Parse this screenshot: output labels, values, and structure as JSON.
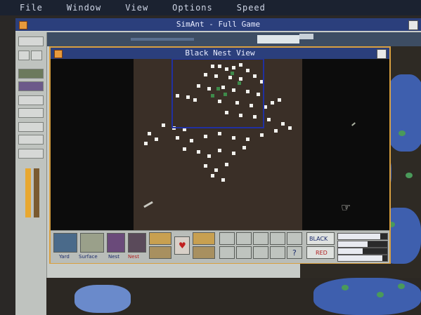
{
  "menubar": {
    "items": [
      "File",
      "Window",
      "View",
      "Options",
      "Speed"
    ]
  },
  "main_window": {
    "title": "SimAnt - Full Game"
  },
  "sub_window": {
    "title": "Black Nest View"
  },
  "controls": {
    "yard_label": "Yard",
    "surface_label": "Surface",
    "nest_label": "Nest",
    "nest2_label": "Nest",
    "black_label": "BLACK",
    "red_label": "RED",
    "help_label": "?"
  },
  "gauges": [
    {
      "fraction": 0.85
    },
    {
      "fraction": 0.6
    },
    {
      "fraction": 0.5
    },
    {
      "fraction": 0.9
    }
  ],
  "colors": {
    "titlebar": "#2b3f7c",
    "accent": "#d9a040",
    "anthill": "#3a2f27"
  }
}
